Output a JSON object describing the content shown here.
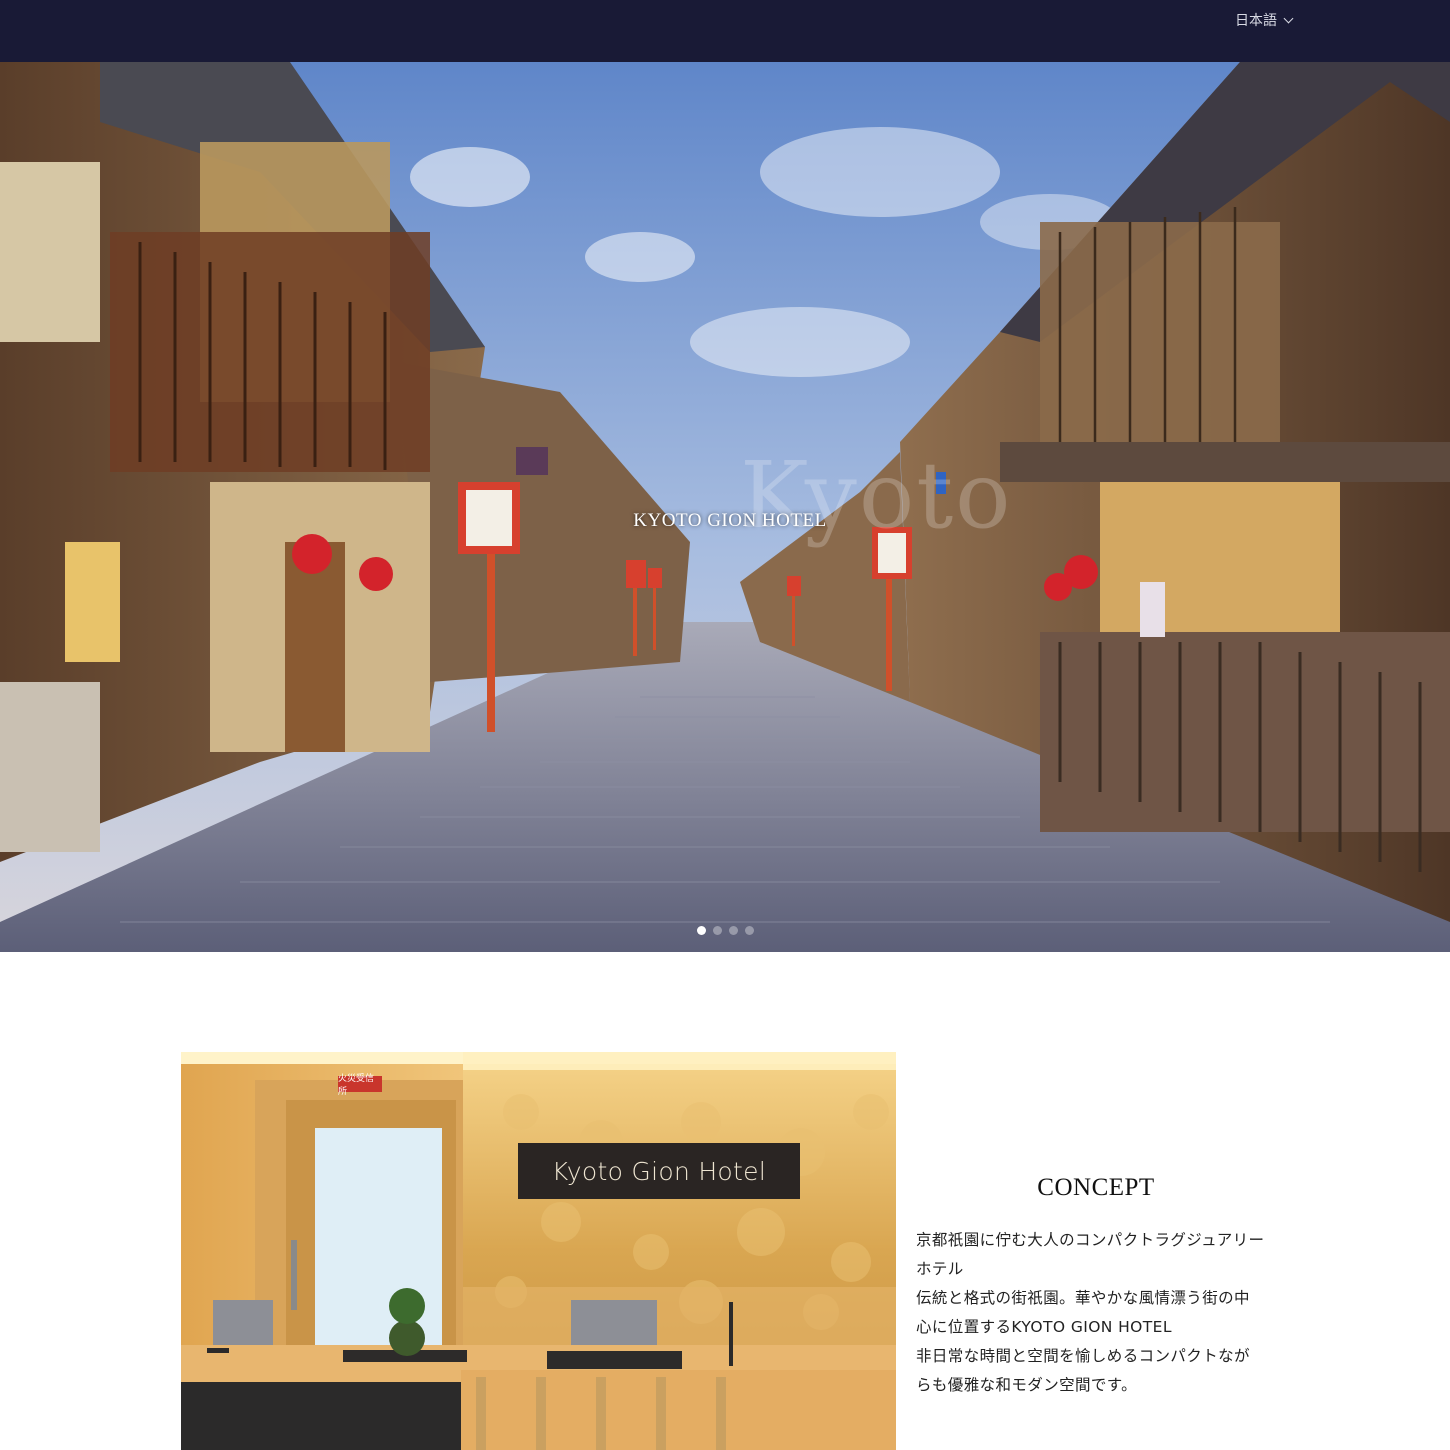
{
  "header": {
    "language_label": "日本語",
    "background_color": "#191a36"
  },
  "hero": {
    "watermark_text": "Kyoto",
    "title": "KYOTO GION HOTEL",
    "slide_count": 4,
    "active_slide": 1
  },
  "concept": {
    "photo_sign_text": "Kyoto Gion Hotel",
    "photo_fire_label": "火災受信所",
    "heading": "CONCEPT",
    "body_lines": [
      "京都祇園に佇む大人のコンパクトラグジュアリー",
      "ホテル",
      "伝統と格式の街祇園。華やかな風情漂う街の中",
      "心に位置するKYOTO GION HOTEL",
      "非日常な時間と空間を愉しめるコンパクトなが",
      "らも優雅な和モダン空間です。"
    ]
  },
  "icons": {
    "language_dropdown": "chevron-down-icon"
  }
}
